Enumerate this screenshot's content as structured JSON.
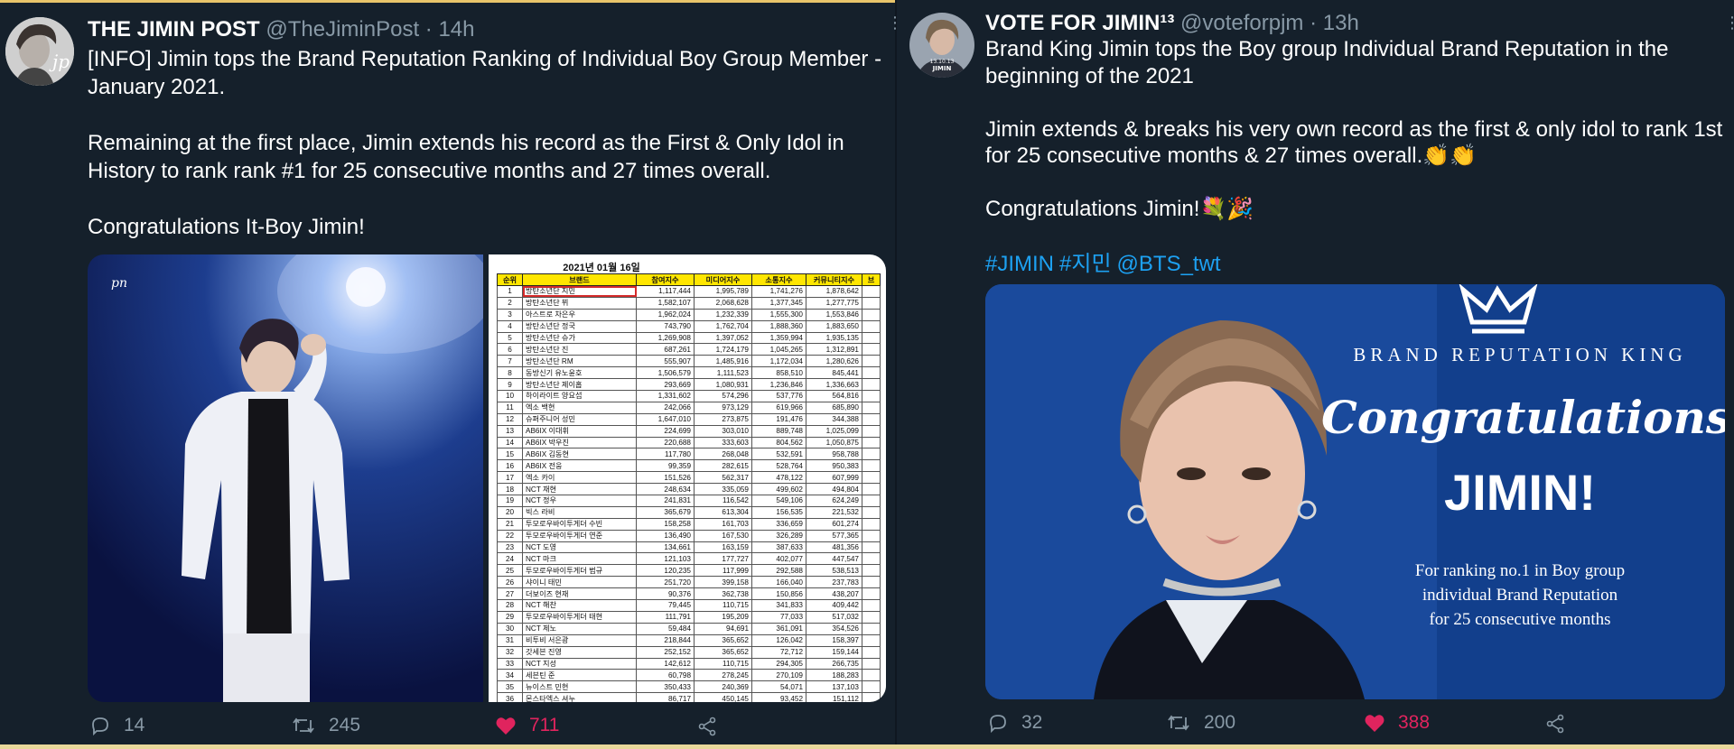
{
  "left_tweet": {
    "display_name": "THE JIMIN POST",
    "handle": "@TheJiminPost",
    "separator": "·",
    "time": "14h",
    "body": "[INFO] Jimin tops the Brand Reputation Ranking of Individual Boy Group Member - January 2021.\n\nRemaining at the first place, Jimin extends his record as the First & Only Idol in History to rank rank #1 for 25 consecutive months and 27 times overall.\n\nCongratulations It-Boy Jimin!",
    "avatar_text": "jp",
    "photo_watermark": "pn",
    "ranking_image": {
      "date": "2021년 01월 16일",
      "headers": [
        "순위",
        "브랜드",
        "참여지수",
        "미디어지수",
        "소통지수",
        "커뮤니티지수",
        "브"
      ],
      "rows": [
        [
          "1",
          "방탄소년단 지민",
          "1,117,444",
          "1,995,789",
          "1,741,276",
          "1,878,642"
        ],
        [
          "2",
          "방탄소년단 뷔",
          "1,582,107",
          "2,068,628",
          "1,377,345",
          "1,277,775"
        ],
        [
          "3",
          "아스트로 차은우",
          "1,962,024",
          "1,232,339",
          "1,555,300",
          "1,553,846"
        ],
        [
          "4",
          "방탄소년단 정국",
          "743,790",
          "1,762,704",
          "1,888,360",
          "1,883,650"
        ],
        [
          "5",
          "방탄소년단 슈가",
          "1,269,908",
          "1,397,052",
          "1,359,994",
          "1,935,135"
        ],
        [
          "6",
          "방탄소년단 진",
          "687,261",
          "1,724,179",
          "1,045,265",
          "1,312,891"
        ],
        [
          "7",
          "방탄소년단 RM",
          "555,907",
          "1,485,916",
          "1,172,034",
          "1,280,626"
        ],
        [
          "8",
          "동방신기 유노윤호",
          "1,506,579",
          "1,111,523",
          "858,510",
          "845,441"
        ],
        [
          "9",
          "방탄소년단 제이홉",
          "293,669",
          "1,080,931",
          "1,236,846",
          "1,336,663"
        ],
        [
          "10",
          "하이라이트 양요섭",
          "1,331,602",
          "574,296",
          "537,776",
          "564,816"
        ],
        [
          "11",
          "엑소 백현",
          "242,066",
          "973,129",
          "619,966",
          "685,890"
        ],
        [
          "12",
          "슈퍼주니어 성민",
          "1,647,010",
          "273,875",
          "191,476",
          "344,388"
        ],
        [
          "13",
          "AB6IX 이대휘",
          "224,699",
          "303,010",
          "889,748",
          "1,025,099"
        ],
        [
          "14",
          "AB6IX 박우진",
          "220,688",
          "333,603",
          "804,562",
          "1,050,875"
        ],
        [
          "15",
          "AB6IX 김동현",
          "117,780",
          "268,048",
          "532,591",
          "958,788"
        ],
        [
          "16",
          "AB6IX 전웅",
          "99,359",
          "282,615",
          "528,764",
          "950,383"
        ],
        [
          "17",
          "엑소 카이",
          "151,526",
          "562,317",
          "478,122",
          "607,999"
        ],
        [
          "18",
          "NCT 재현",
          "248,634",
          "335,059",
          "499,602",
          "494,804"
        ],
        [
          "19",
          "NCT 정우",
          "241,831",
          "116,542",
          "549,106",
          "624,249"
        ],
        [
          "20",
          "빅스 라비",
          "365,679",
          "613,304",
          "156,535",
          "221,532"
        ],
        [
          "21",
          "투모로우바이투게더 수빈",
          "158,258",
          "161,703",
          "336,659",
          "601,274"
        ],
        [
          "22",
          "투모로우바이투게더 연준",
          "136,490",
          "167,530",
          "326,289",
          "577,365"
        ],
        [
          "23",
          "NCT 도영",
          "134,661",
          "163,159",
          "387,633",
          "481,356"
        ],
        [
          "24",
          "NCT 마크",
          "121,103",
          "177,727",
          "402,077",
          "447,547"
        ],
        [
          "25",
          "투모로우바이투게더 범규",
          "120,235",
          "117,999",
          "292,588",
          "538,513"
        ],
        [
          "26",
          "샤이니 태민",
          "251,720",
          "399,158",
          "166,040",
          "237,783"
        ],
        [
          "27",
          "더보이즈 현재",
          "90,376",
          "362,738",
          "150,856",
          "438,207"
        ],
        [
          "28",
          "NCT 해찬",
          "79,445",
          "110,715",
          "341,833",
          "409,442"
        ],
        [
          "29",
          "투모로우바이투게더 태현",
          "111,791",
          "195,209",
          "77,033",
          "517,032"
        ],
        [
          "30",
          "NCT 제노",
          "59,484",
          "94,691",
          "361,091",
          "354,526"
        ],
        [
          "31",
          "비투비 서은광",
          "218,844",
          "365,652",
          "126,042",
          "158,397"
        ],
        [
          "32",
          "갓세븐 진영",
          "252,152",
          "365,652",
          "72,712",
          "159,144"
        ],
        [
          "33",
          "NCT 지성",
          "142,612",
          "110,715",
          "294,305",
          "266,735"
        ],
        [
          "34",
          "세븐틴 준",
          "60,798",
          "278,245",
          "270,109",
          "188,283"
        ],
        [
          "35",
          "뉴이스트 민현",
          "350,433",
          "240,369",
          "54,071",
          "137,103"
        ],
        [
          "36",
          "몬스타엑스 셔누",
          "86,717",
          "450,145",
          "93,452",
          "151,112"
        ]
      ]
    },
    "actions": {
      "replies": "14",
      "retweets": "245",
      "likes": "711"
    }
  },
  "right_tweet": {
    "display_name": "VOTE FOR JIMIN¹³",
    "handle": "@voteforpjm",
    "separator": "·",
    "time": "13h",
    "avatar_text": "13.10.13\nJIMIN",
    "body": "Brand King Jimin tops the Boy group Individual Brand Reputation in the beginning of the 2021\n\nJimin extends & breaks his very own record as the first & only idol to rank 1st for 25 consecutive months & 27 times overall.👏👏\n\nCongratulations Jimin!💐🎉",
    "hashtags": [
      "#JIMIN",
      "#지민",
      "@BTS_twt"
    ],
    "graphic": {
      "heading": "BRAND REPUTATION KING",
      "script": "Congratulations",
      "name": "JIMIN!",
      "caption": "For ranking no.1 in Boy group\nindividual Brand Reputation\nfor 25 consecutive months",
      "background": "#123f8c"
    },
    "actions": {
      "replies": "32",
      "retweets": "200",
      "likes": "388"
    }
  },
  "colors": {
    "background": "#15202b",
    "link": "#1da1f2",
    "like": "#e0245e",
    "muted": "#8899a6"
  }
}
